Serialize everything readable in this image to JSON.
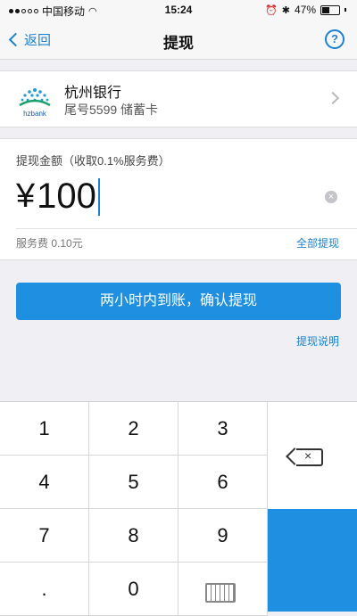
{
  "status_bar": {
    "carrier": "中国移动",
    "time": "15:24",
    "battery": "47%",
    "battery_level": 0.47
  },
  "nav": {
    "back_label": "返回",
    "title": "提现",
    "help_icon": "question-circle-icon",
    "help_glyph": "?"
  },
  "bank": {
    "name": "杭州银行",
    "card_info": "尾号5599 储蓄卡",
    "logo_text": "hzbank"
  },
  "amount": {
    "label": "提现金额（收取0.1%服务费）",
    "currency": "¥",
    "value": "100",
    "fee": "服务费 0.10元",
    "withdraw_all": "全部提现"
  },
  "confirm_button": "两小时内到账，确认提现",
  "explain_link": "提现说明",
  "keypad": {
    "keys": [
      "1",
      "2",
      "3",
      "4",
      "5",
      "6",
      "7",
      "8",
      "9",
      ".",
      "0"
    ],
    "delete_icon": "backspace-icon",
    "hide_icon": "keyboard-hide-icon"
  },
  "colors": {
    "accent": "#1b82d2",
    "button": "#1e8fe1",
    "background": "#efeff4"
  }
}
